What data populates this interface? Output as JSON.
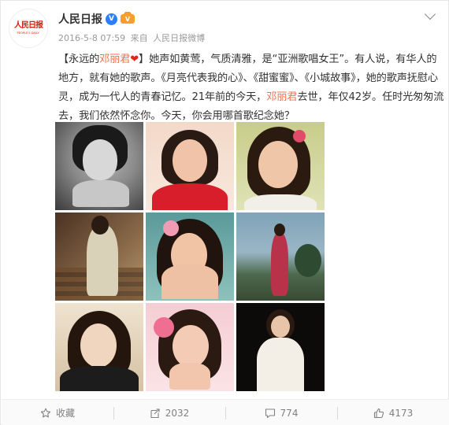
{
  "account": {
    "name": "人民日报",
    "logo_text": "人民日报",
    "logo_sub": "PEOPLE'S DAILY",
    "verified_mark": "V",
    "vip_mark": "V"
  },
  "meta": {
    "timestamp": "2016-5-8 07:59",
    "source_prefix": "来自",
    "source": "人民日报微博"
  },
  "post": {
    "open_bracket": "【永远的",
    "name": "邓丽君",
    "heart": "❤",
    "text_1": "】她声如黄莺，气质清雅，是“亚洲歌唱女王”。有人说，有华人的地方，就有她的歌声。《月亮代表我的心》、《甜蜜蜜》、《小城故事》，她的歌声抚慰心灵，成为一代人的青春记忆。21年前的今天，",
    "name_2": "邓丽君",
    "text_2": "去世，年仅42岁。任时光匆匆流去，我们依然怀念你。今天，你会用哪首歌纪念她？"
  },
  "actions": {
    "favorite_label": "收藏",
    "repost_count": "2032",
    "comment_count": "774",
    "like_count": "4173"
  },
  "icons": {
    "favorite": "star-icon",
    "repost": "repost-icon",
    "comment": "comment-icon",
    "like": "thumbs-up-icon",
    "menu": "chevron-down-icon"
  },
  "colors": {
    "highlight": "#eb7350",
    "verified": "#2d7ff9",
    "logo": "#d81e06"
  }
}
